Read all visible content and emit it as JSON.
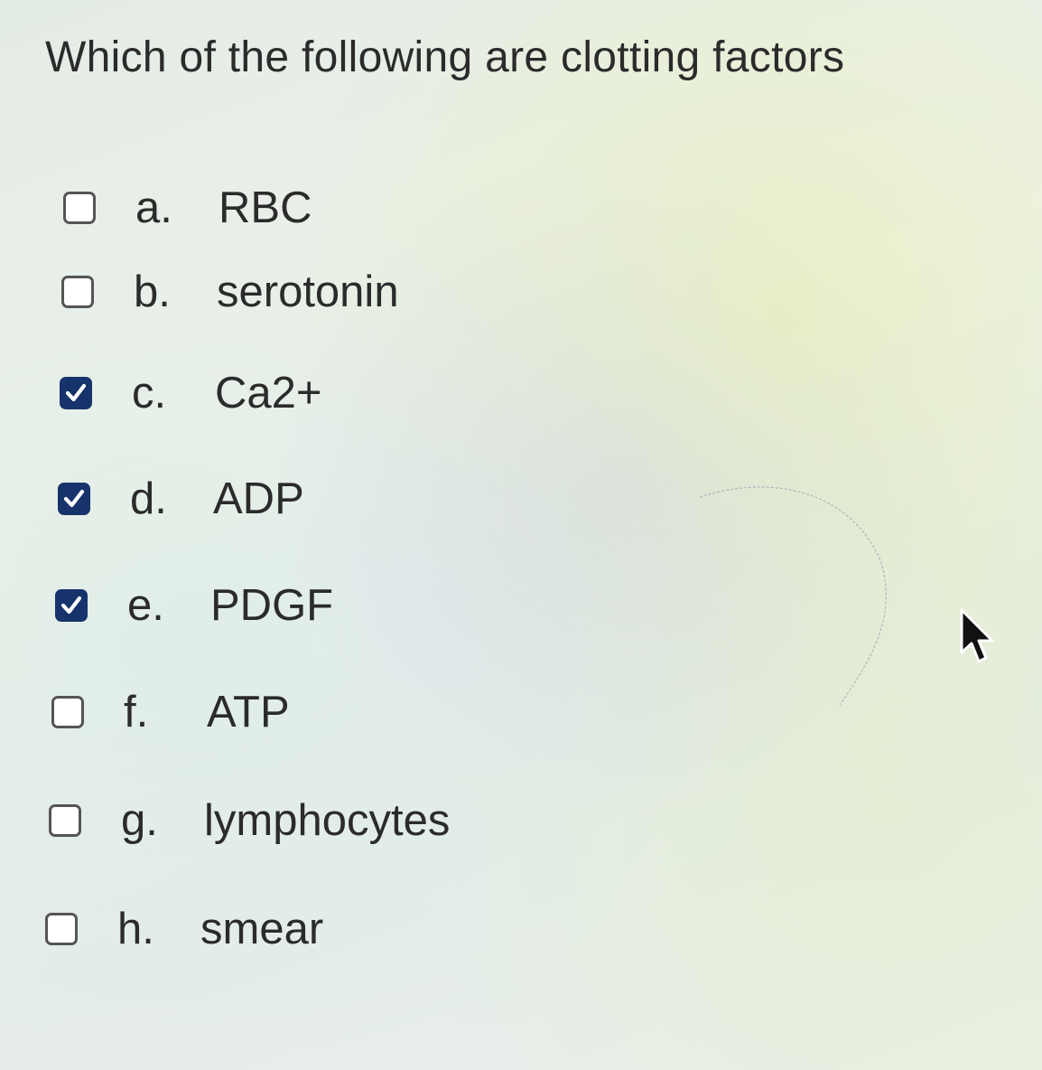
{
  "question": "Which of the following are clotting factors",
  "options": [
    {
      "letter": "a.",
      "label": "RBC",
      "checked": false
    },
    {
      "letter": "b.",
      "label": "serotonin",
      "checked": false
    },
    {
      "letter": "c.",
      "label": "Ca2+",
      "checked": true
    },
    {
      "letter": "d.",
      "label": "ADP",
      "checked": true
    },
    {
      "letter": "e.",
      "label": "PDGF",
      "checked": true
    },
    {
      "letter": "f.",
      "label": "ATP",
      "checked": false
    },
    {
      "letter": "g.",
      "label": "lymphocytes",
      "checked": false
    },
    {
      "letter": "h.",
      "label": "smear",
      "checked": false
    }
  ],
  "colors": {
    "checkbox_checked": "#17336b",
    "checkbox_border": "#555555",
    "text": "#2b2b2b"
  },
  "icons": {
    "checkmark": "checkmark-icon",
    "cursor": "mouse-pointer-icon"
  }
}
